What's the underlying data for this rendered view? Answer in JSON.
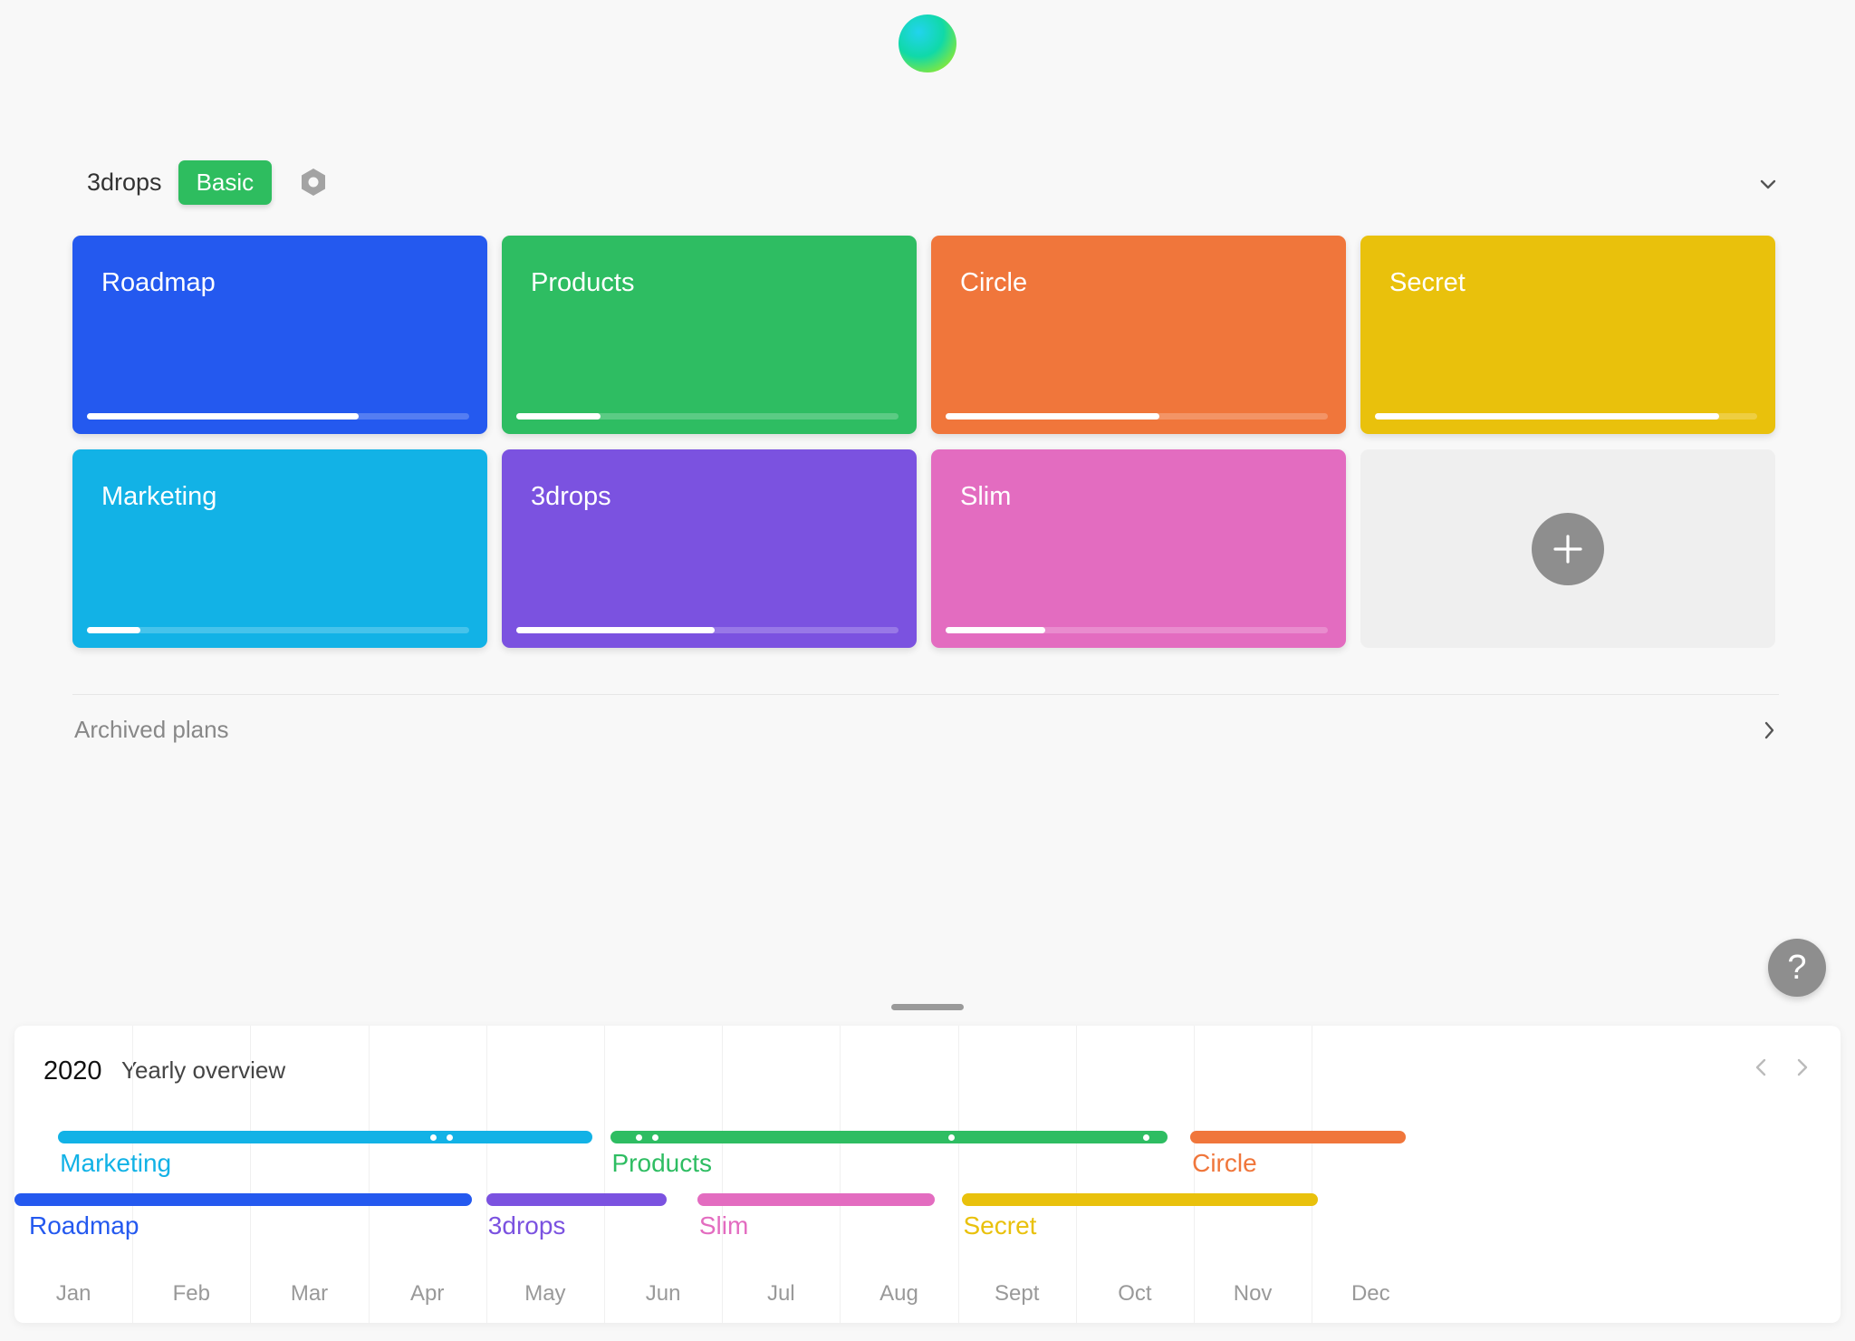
{
  "workspace": {
    "name": "3drops",
    "plan_badge": "Basic",
    "settings_icon": "gear-icon",
    "collapse_icon": "chevron-down-icon"
  },
  "plans": [
    {
      "title": "Roadmap",
      "color": "#2459ef",
      "progress": 0.71
    },
    {
      "title": "Products",
      "color": "#2ebd62",
      "progress": 0.22
    },
    {
      "title": "Circle",
      "color": "#f0763b",
      "progress": 0.56
    },
    {
      "title": "Secret",
      "color": "#e9c10c",
      "progress": 0.9
    },
    {
      "title": "Marketing",
      "color": "#12b2e6",
      "progress": 0.14
    },
    {
      "title": "3drops",
      "color": "#7b52e0",
      "progress": 0.52
    },
    {
      "title": "Slim",
      "color": "#e36cc0",
      "progress": 0.26
    }
  ],
  "add_plan_icon": "plus-icon",
  "archived": {
    "label": "Archived plans",
    "icon": "chevron-right-icon"
  },
  "help": {
    "label": "?"
  },
  "overview": {
    "year": "2020",
    "title": "Yearly overview",
    "months": [
      "Jan",
      "Feb",
      "Mar",
      "Apr",
      "May",
      "Jun",
      "Jul",
      "Aug",
      "Sept",
      "Oct",
      "Nov",
      "Dec"
    ],
    "timeline": [
      {
        "plan": "Marketing",
        "color": "#12b2e6",
        "row": 0,
        "start_month": 0.37,
        "end_month": 4.9,
        "milestones": [
          3.55,
          3.69
        ]
      },
      {
        "plan": "Products",
        "color": "#2ebd62",
        "row": 0,
        "start_month": 5.05,
        "end_month": 9.78,
        "milestones": [
          5.29,
          5.43,
          7.94,
          9.59
        ]
      },
      {
        "plan": "Circle",
        "color": "#f0763b",
        "row": 0,
        "start_month": 9.97,
        "end_month": 11.8,
        "milestones": []
      },
      {
        "plan": "Roadmap",
        "color": "#2459ef",
        "row": 1,
        "start_month": 0.0,
        "end_month": 3.88,
        "milestones": []
      },
      {
        "plan": "3drops",
        "color": "#7b52e0",
        "row": 1,
        "start_month": 4.0,
        "end_month": 5.53,
        "milestones": []
      },
      {
        "plan": "Slim",
        "color": "#e36cc0",
        "row": 1,
        "start_month": 5.79,
        "end_month": 7.8,
        "milestones": []
      },
      {
        "plan": "Secret",
        "color": "#e9c10c",
        "row": 1,
        "start_month": 8.03,
        "end_month": 11.05,
        "milestones": []
      }
    ]
  }
}
